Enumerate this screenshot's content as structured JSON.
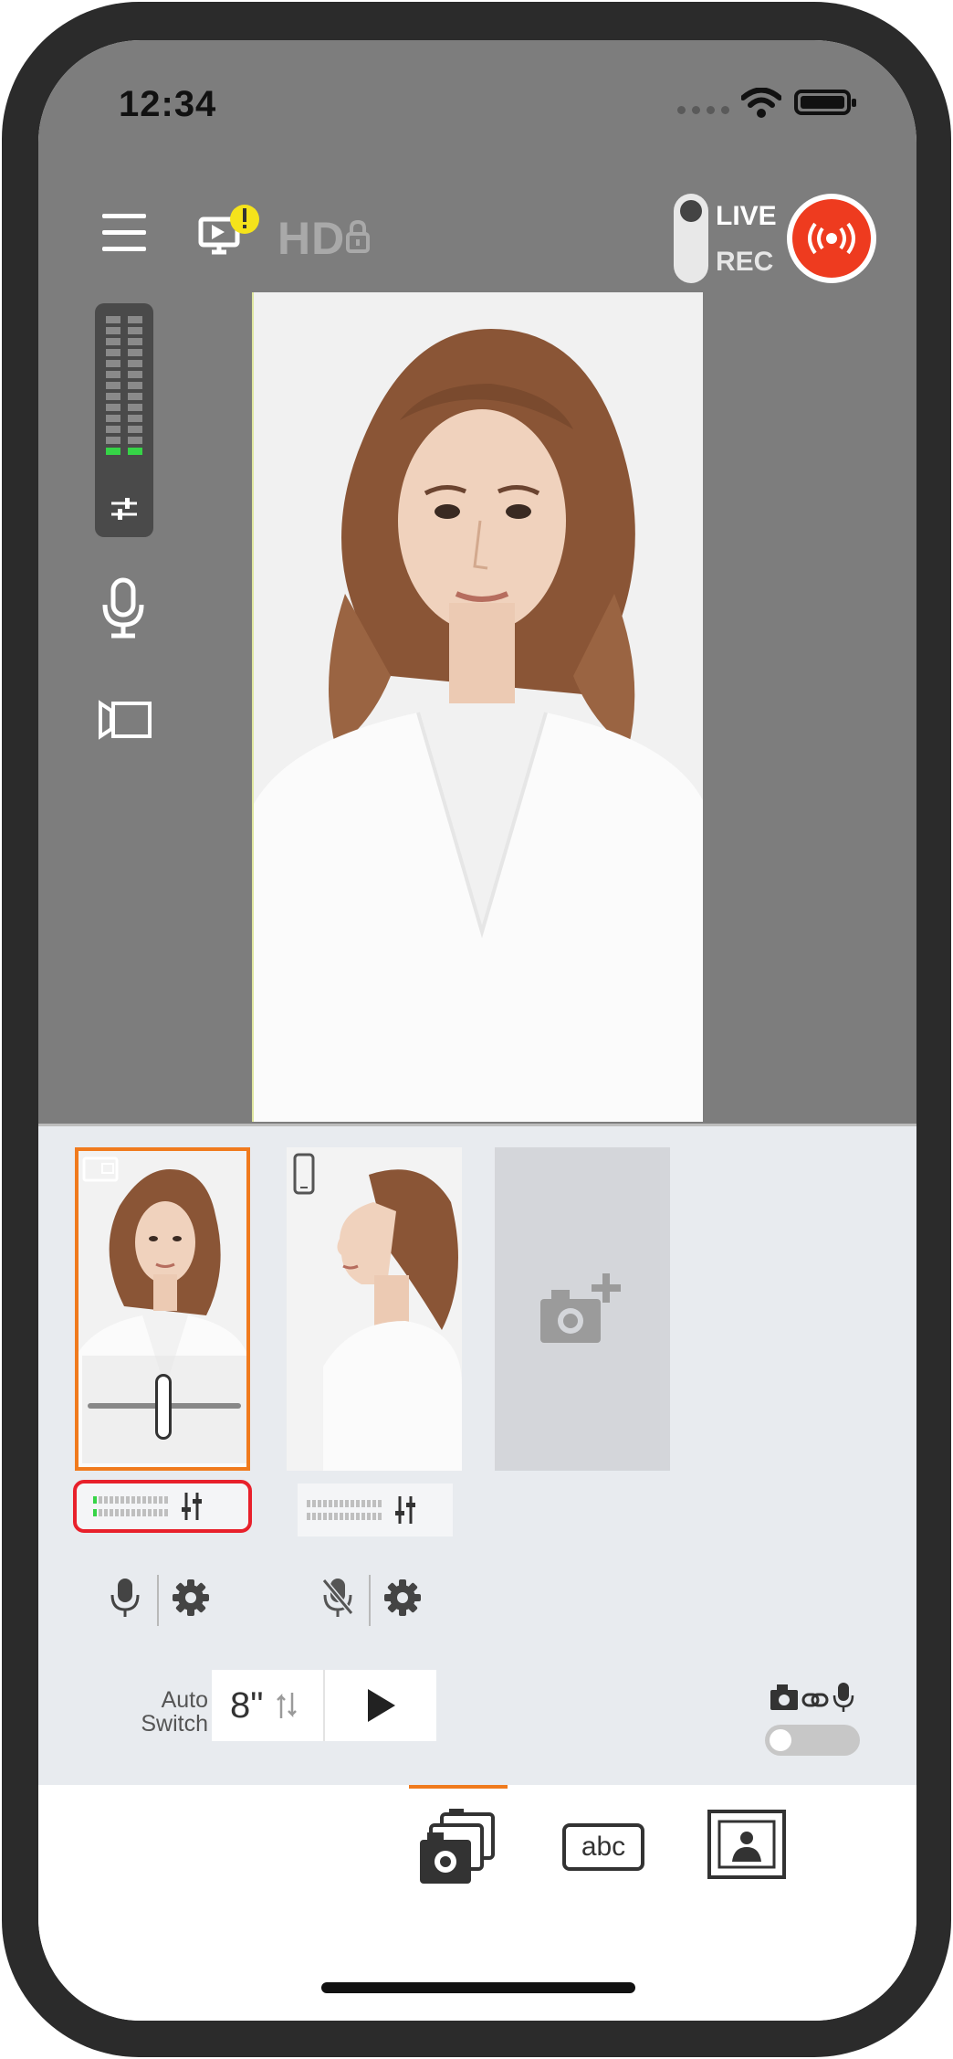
{
  "status_bar": {
    "time": "12:34",
    "icons": [
      "signal-icon",
      "wifi-icon",
      "battery-icon"
    ]
  },
  "top_bar": {
    "menu_icon": "hamburger-menu-icon",
    "cast_icon": "cast-warning-icon",
    "quality_label": "HD",
    "quality_locked": true,
    "mode_options": [
      "LIVE",
      "REC"
    ],
    "selected_mode": "LIVE",
    "record_button_icon": "broadcast-icon",
    "accent_color": "#ee3b1f"
  },
  "left_tools": {
    "level_meter_icon": "audio-level-adjust-icon",
    "mic_icon": "microphone-icon",
    "video_icon": "video-camera-icon"
  },
  "sources": [
    {
      "badge_icon": "landscape-camera-icon",
      "selected": true,
      "mic_icon": "microphone-icon",
      "settings_icon": "gear-icon",
      "muted": false
    },
    {
      "badge_icon": "smartphone-icon",
      "selected": false,
      "mic_icon": "microphone-muted-icon",
      "settings_icon": "gear-icon",
      "muted": true
    }
  ],
  "add_source_icon": "add-camera-icon",
  "auto_switch": {
    "label_line1": "Auto",
    "label_line2": "Switch",
    "interval": "8\"",
    "play_icon": "play-icon",
    "enabled": false
  },
  "link_toggle": {
    "icons": [
      "camera-icon",
      "link-icon",
      "microphone-icon"
    ],
    "enabled": false
  },
  "tabs": [
    {
      "name": "cameras",
      "icon": "multi-camera-icon",
      "selected": true
    },
    {
      "name": "text",
      "label": "abc",
      "icon": "text-overlay-icon",
      "selected": false
    },
    {
      "name": "image",
      "icon": "image-overlay-icon",
      "selected": false
    }
  ],
  "colors": {
    "selection": "#f07a1d",
    "meter_active": "#36d447",
    "highlight_box": "#e8202b"
  }
}
